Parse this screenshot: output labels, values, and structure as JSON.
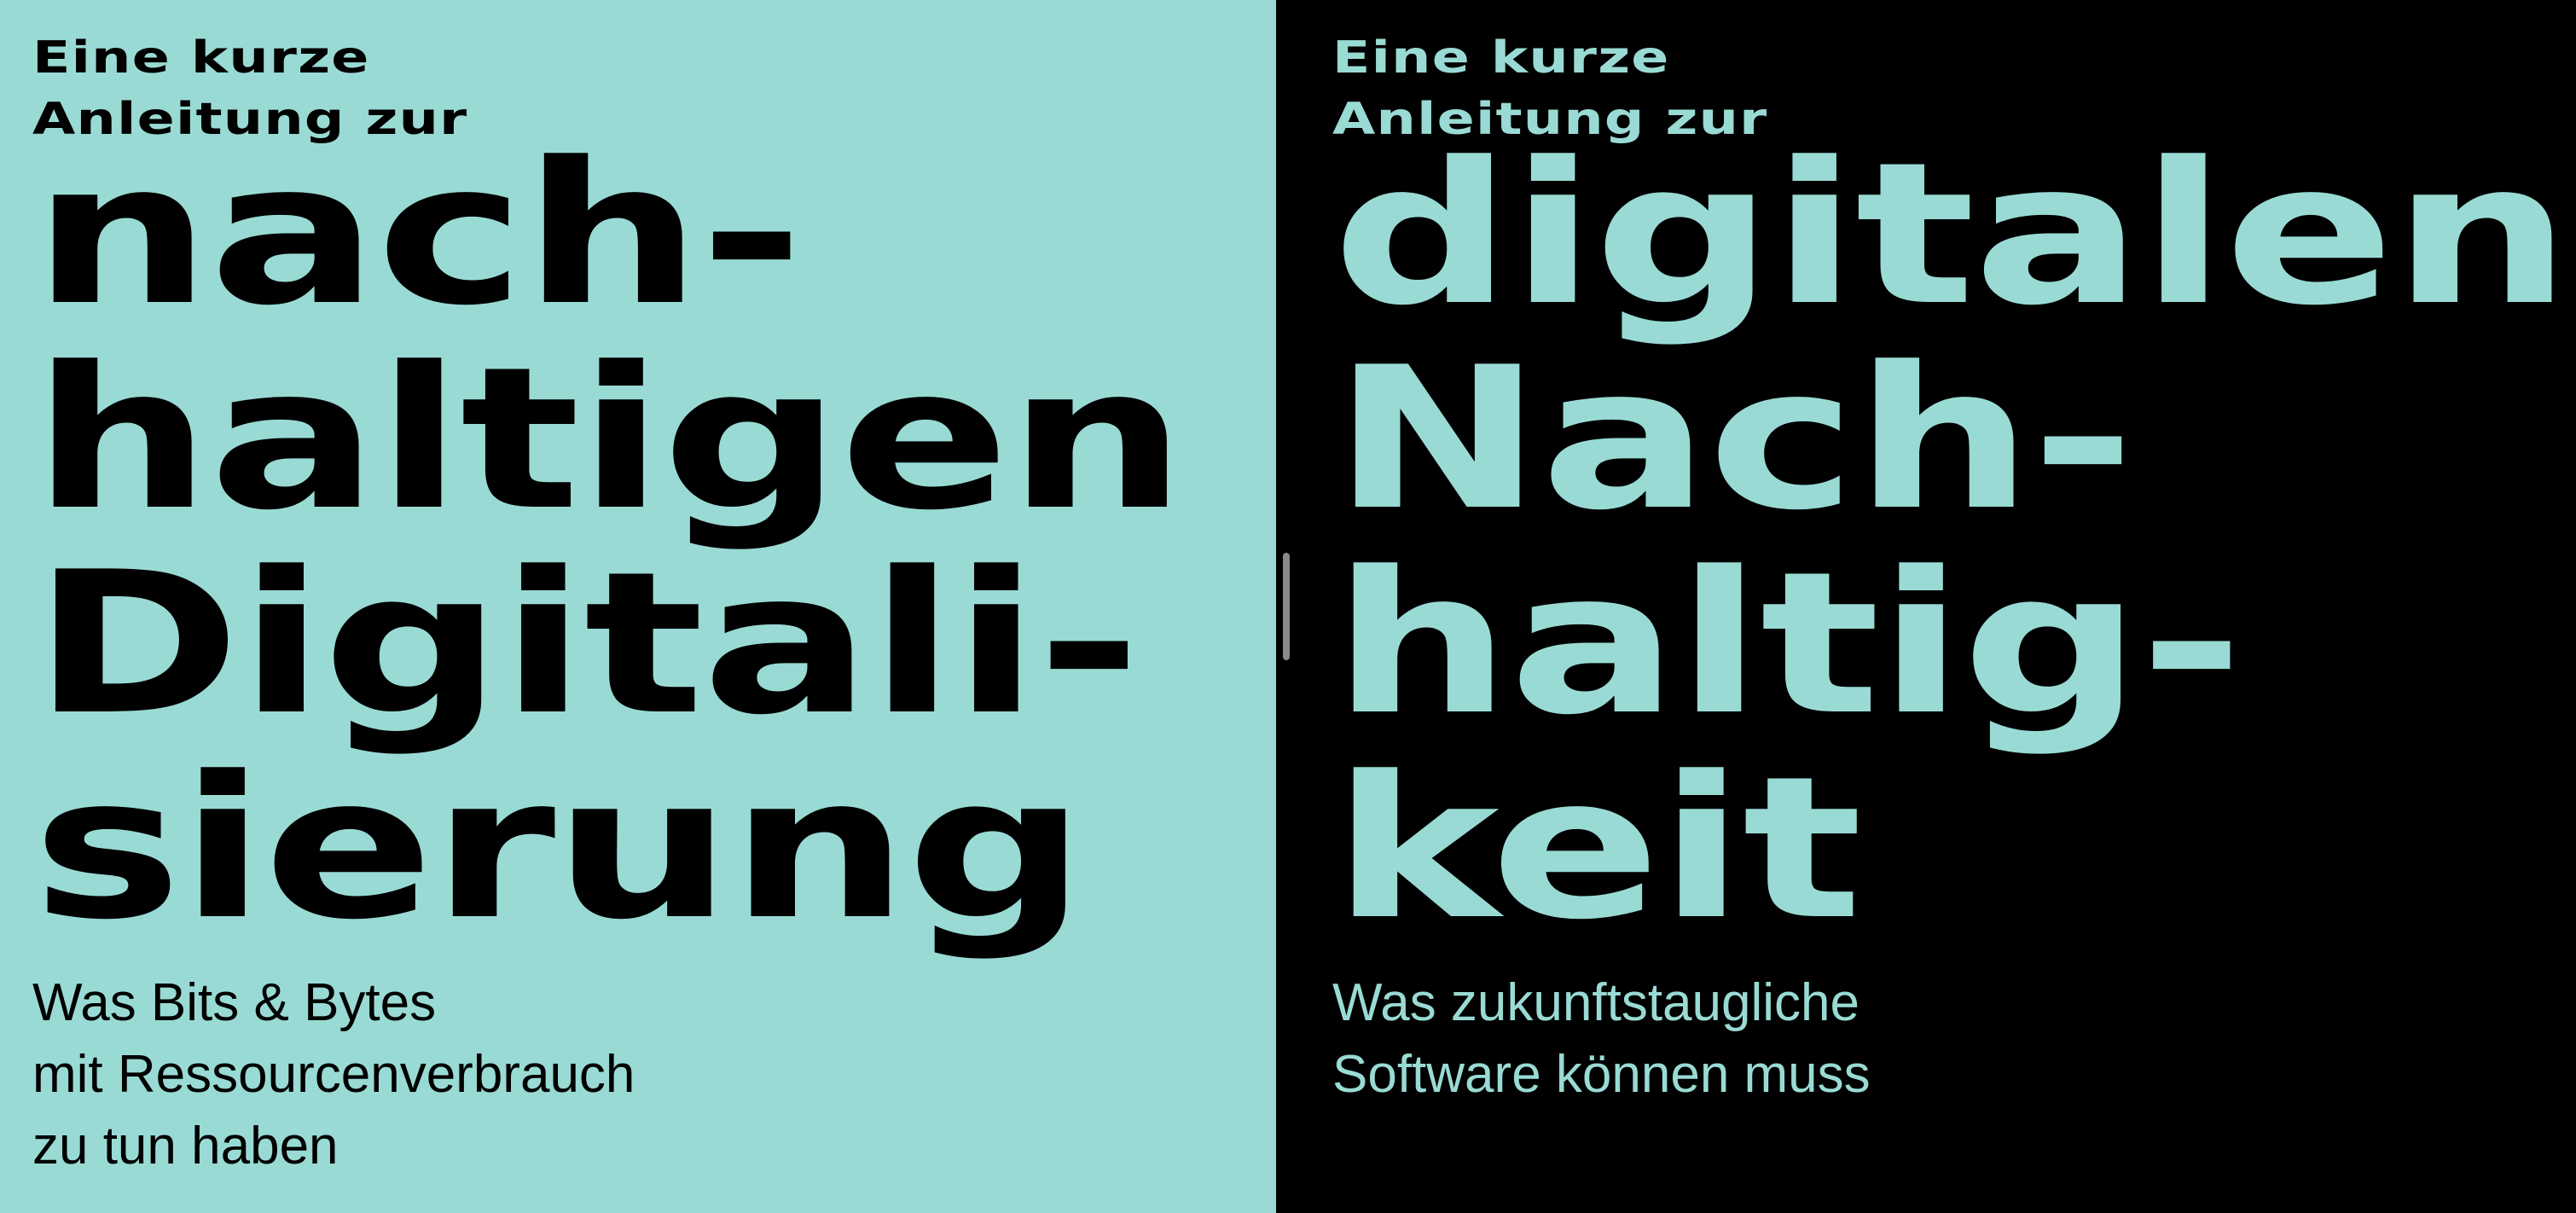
{
  "left": {
    "kicker": "Eine kurze\nAnleitung zur",
    "headline": "nach-\nhaltigen\nDigitali-\nsierung",
    "subtitle": "Was Bits & Bytes\nmit Ressourcenverbrauch\nzu tun haben",
    "background": "#99dbd4",
    "text_color": "#000000"
  },
  "right": {
    "kicker": "Eine kurze\nAnleitung zur",
    "headline": "digitalen\nNach-\nhaltig-\nkeit",
    "subtitle": "Was zukunftstaugliche\nSoftware können muss",
    "background": "#000000",
    "text_color": "#99dbd4"
  },
  "divider": {
    "icon": "drag-handle-icon"
  }
}
